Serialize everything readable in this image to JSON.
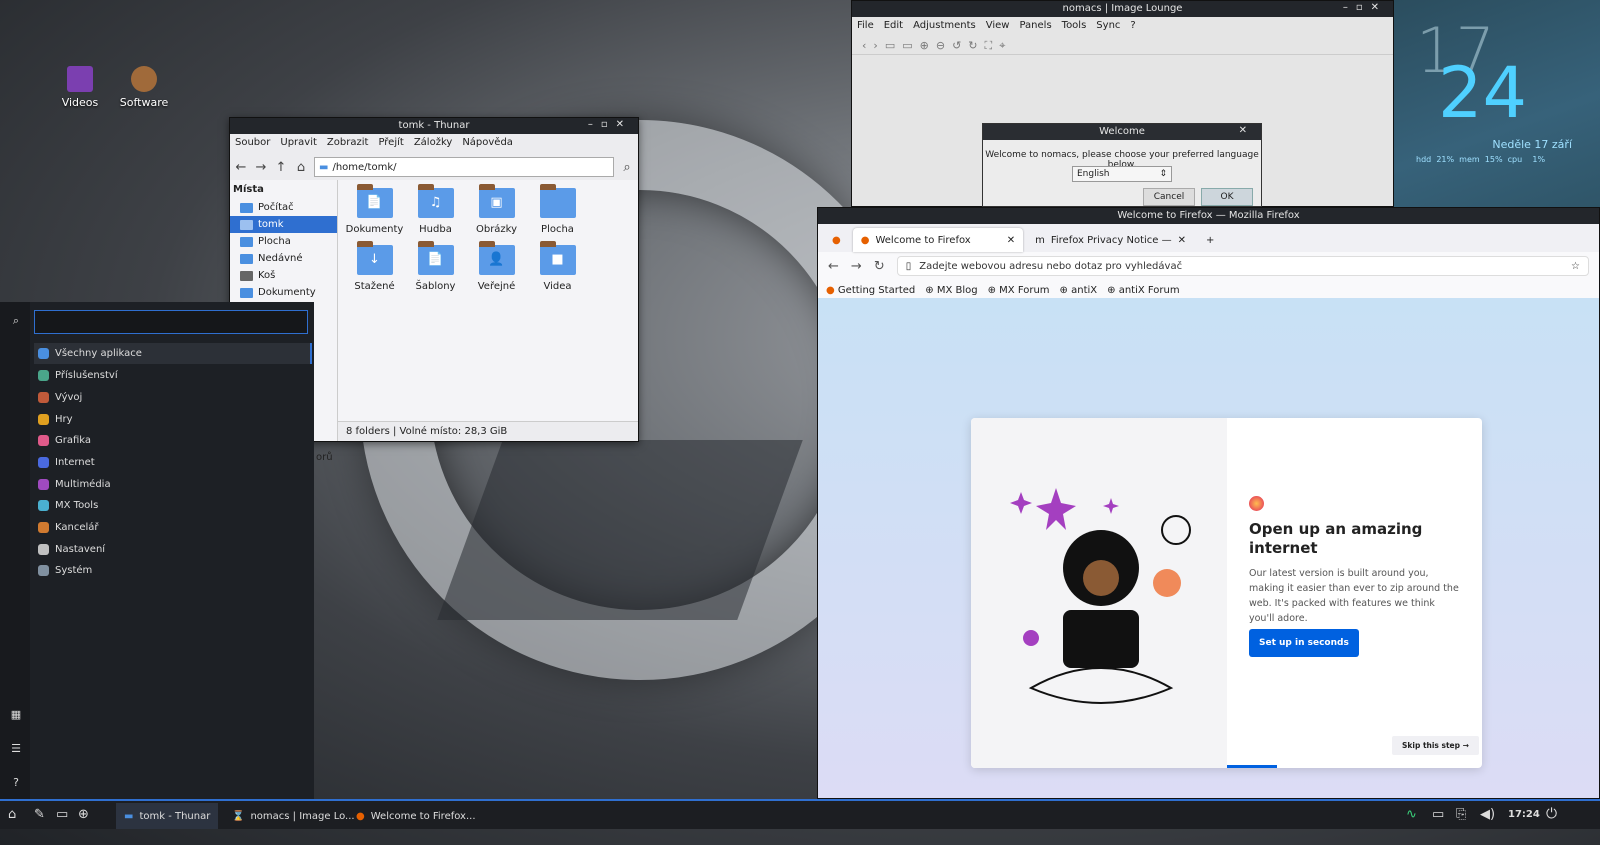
{
  "desktop": {
    "icons": [
      {
        "label": "Videos",
        "color": "#7b3fb0"
      },
      {
        "label": "Software",
        "color": "#a06a3a"
      }
    ]
  },
  "thunar": {
    "title": "tomk - Thunar",
    "menu": [
      "Soubor",
      "Upravit",
      "Zobrazit",
      "Přejít",
      "Záložky",
      "Nápověda"
    ],
    "path": "/home/tomk/",
    "places_header": "Místa",
    "places": [
      "Počítač",
      "tomk",
      "Plocha",
      "Nedávné",
      "Koš",
      "Dokumenty"
    ],
    "folders": [
      {
        "label": "Dokumenty",
        "icon": "📄"
      },
      {
        "label": "Hudba",
        "icon": "♫"
      },
      {
        "label": "Obrázky",
        "icon": "▣"
      },
      {
        "label": "Plocha",
        "icon": ""
      },
      {
        "label": "Stažené",
        "icon": "↓"
      },
      {
        "label": "Šablony",
        "icon": "📄"
      },
      {
        "label": "Veřejné",
        "icon": "👤"
      },
      {
        "label": "Videa",
        "icon": "■"
      }
    ],
    "status": "8 folders  |  Volné místo: 28,3 GiB",
    "cut_text": "orů"
  },
  "menu": {
    "categories": [
      {
        "label": "Všechny aplikace",
        "color": "#4a8fe0"
      },
      {
        "label": "Příslušenství",
        "color": "#4aa58a"
      },
      {
        "label": "Vývoj",
        "color": "#c05a3a"
      },
      {
        "label": "Hry",
        "color": "#e0a020"
      },
      {
        "label": "Grafika",
        "color": "#e05a8a"
      },
      {
        "label": "Internet",
        "color": "#4a6ae0"
      },
      {
        "label": "Multimédia",
        "color": "#a04ac0"
      },
      {
        "label": "MX Tools",
        "color": "#4ab0d0"
      },
      {
        "label": "Kancelář",
        "color": "#d07a30"
      },
      {
        "label": "Nastavení",
        "color": "#c0c0c0"
      },
      {
        "label": "Systém",
        "color": "#8090a0"
      }
    ]
  },
  "nomacs": {
    "title": "nomacs | Image Lounge",
    "menu": [
      "File",
      "Edit",
      "Adjustments",
      "View",
      "Panels",
      "Tools",
      "Sync",
      "?"
    ],
    "dialog": {
      "title": "Welcome",
      "text": "Welcome to nomacs, please choose your preferred language below.",
      "language": "English",
      "cancel": "Cancel",
      "ok": "OK"
    }
  },
  "clock": {
    "hour": "17",
    "minute": "24",
    "date": "Neděle  17 září",
    "stats": "hdd  21%  mem  15%  cpu    1%"
  },
  "firefox": {
    "title": "Welcome to Firefox — Mozilla Firefox",
    "tabs": [
      "Welcome to Firefox",
      "Firefox Privacy Notice —"
    ],
    "url_placeholder": "Zadejte webovou adresu nebo dotaz pro vyhledávač",
    "bookmarks": [
      "Getting Started",
      "MX Blog",
      "MX Forum",
      "antiX",
      "antiX Forum"
    ],
    "heading": "Open up an amazing internet",
    "body": "Our latest version is built around you, making it easier than ever to zip around the web. It's packed with features we think you'll adore.",
    "cta": "Set up in seconds",
    "skip": "Skip this step →"
  },
  "taskbar": {
    "apps": [
      "tomk - Thunar",
      "nomacs | Image Lo...",
      "Welcome to Firefox..."
    ],
    "time": "17:24"
  }
}
